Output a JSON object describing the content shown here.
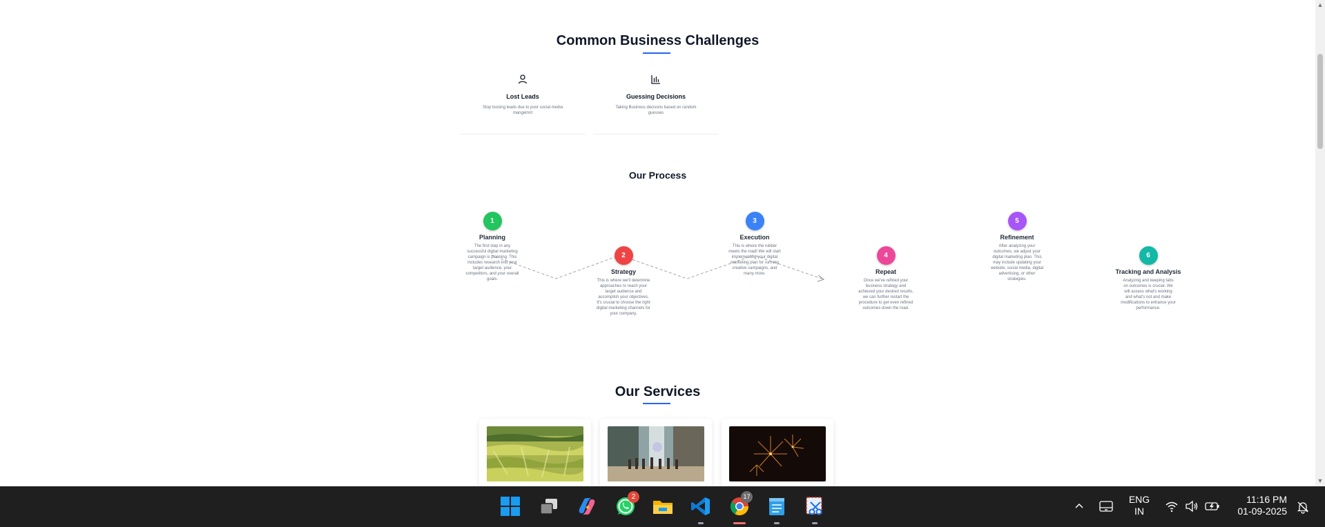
{
  "challenges": {
    "title": "Common Business Challenges",
    "items": [
      {
        "icon": "user-icon",
        "title": "Lost Leads",
        "desc": "Stop loosing leads due to poor social media mangemnt"
      },
      {
        "icon": "bar-chart-icon",
        "title": "Guessing Decisions",
        "desc": "Taking Business decisons based on random guesses"
      }
    ]
  },
  "process": {
    "title": "Our Process",
    "steps": [
      {
        "num": "1",
        "title": "Planning",
        "color": "#22c55e",
        "desc": "The first step in any successful digital marketing campaign is planning. This includes research into your target audience, your competitors, and your overall goals."
      },
      {
        "num": "2",
        "title": "Strategy",
        "color": "#ef4444",
        "desc": "This is where we'll determine approaches to reach your target audience and accomplish your objectives. It's crucial to choose the right digital marketing channels for your company."
      },
      {
        "num": "3",
        "title": "Execution",
        "color": "#3b82f6",
        "desc": "This is where the rubber meets the road! We will start implementing your digital marketing plan for running creative campaigns, and many more."
      },
      {
        "num": "4",
        "title": "Repeat",
        "color": "#ec4899",
        "desc": "Once we've refined your business strategy and achieved your desired results, we can further restart the procedure to get even refined outcomes down the road."
      },
      {
        "num": "5",
        "title": "Refinement",
        "color": "#a855f7",
        "desc": "After analyzing your outcomes, we adjust your digital marketing plan. This may include updating your website, social media, digital advertising, or other strategies."
      },
      {
        "num": "6",
        "title": "Tracking and Analysis",
        "color": "#14b8a6",
        "desc": "Analyzing and keeping tabs on outcomes is crucial. We will assess what's working and what's not and make modifications to enhance your performance."
      }
    ]
  },
  "services": {
    "title": "Our Services",
    "cards": [
      {
        "image": "rice-field-painting"
      },
      {
        "image": "group-at-waterfall"
      },
      {
        "image": "fireworks-night"
      }
    ]
  },
  "taskbar": {
    "apps": [
      {
        "name": "start-button",
        "icon": "windows-icon"
      },
      {
        "name": "task-view-button",
        "icon": "task-view-icon"
      },
      {
        "name": "copilot-button",
        "icon": "copilot-icon"
      },
      {
        "name": "whatsapp-button",
        "icon": "whatsapp-icon",
        "badge": "2"
      },
      {
        "name": "file-explorer-button",
        "icon": "folder-icon"
      },
      {
        "name": "vscode-button",
        "icon": "vscode-icon"
      },
      {
        "name": "chrome-button",
        "icon": "chrome-icon",
        "badge": "17"
      },
      {
        "name": "notepad-button",
        "icon": "notepad-icon"
      },
      {
        "name": "snipping-tool-button",
        "icon": "snipping-tool-icon"
      }
    ],
    "lang_line1": "ENG",
    "lang_line2": "IN",
    "time": "11:16 PM",
    "date": "01-09-2025"
  }
}
